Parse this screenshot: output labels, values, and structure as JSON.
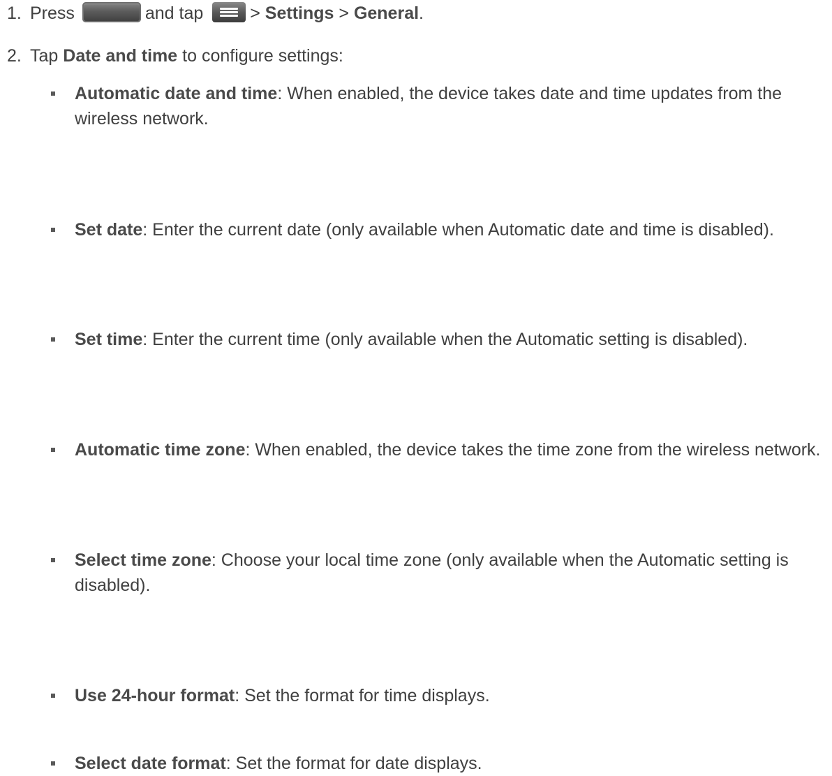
{
  "steps": [
    {
      "number": "1.",
      "text_press": "Press",
      "home_key_icon": "home-key-icon",
      "text_and_tap": "and tap",
      "menu_key_icon": "menu-key-icon",
      "sep1": ">",
      "settings": "Settings",
      "sep2": ">",
      "general": "General",
      "end": "."
    },
    {
      "number": "2.",
      "text_tap": "Tap",
      "date_and_time": "Date and time",
      "rest": "to configure settings:"
    }
  ],
  "options": [
    {
      "term": "Automatic date and time",
      "description": ": When enabled, the device takes date and time updates from the wireless network."
    },
    {
      "term": "Set date",
      "description": ": Enter the current date (only available when Automatic date and time is disabled)."
    },
    {
      "term": "Set time",
      "description": ": Enter the current time (only available when the Automatic setting is disabled)."
    },
    {
      "term": "Automatic time zone",
      "description": ": When enabled, the device takes the time zone from the wireless network."
    },
    {
      "term": "Select time zone",
      "description": ": Choose your local time zone (only available when the Automatic setting is disabled)."
    },
    {
      "term": "Use 24-hour format",
      "description": ": Set the format for time displays."
    },
    {
      "term": "Select date format",
      "description": ": Set the format for date displays."
    }
  ]
}
